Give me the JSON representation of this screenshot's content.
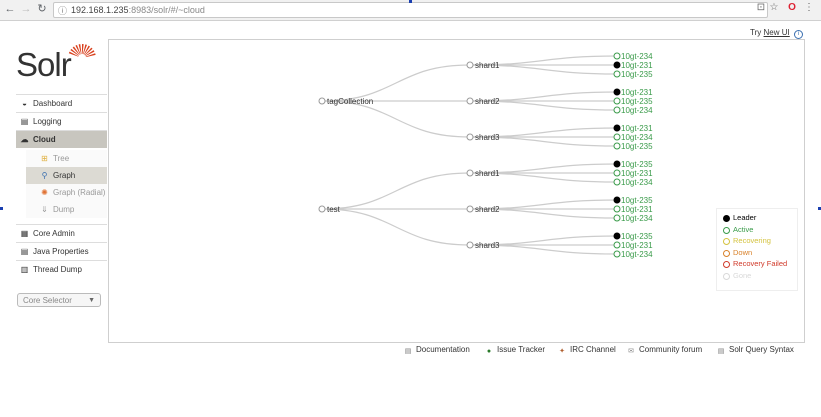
{
  "browser": {
    "url_host": "192.168.1.235",
    "url_path": ":8983/solr/#/~cloud"
  },
  "header": {
    "try_prefix": "Try",
    "new_ui_link": "New UI"
  },
  "logo": {
    "word": "Solr"
  },
  "sidebar": {
    "items": [
      {
        "label": "Dashboard",
        "icon": "dashboard-icon",
        "glyph": "◒"
      },
      {
        "label": "Logging",
        "icon": "logging-icon",
        "glyph": "▤"
      },
      {
        "label": "Cloud",
        "icon": "cloud-icon",
        "glyph": "☁"
      }
    ],
    "sub_items": [
      {
        "label": "Tree",
        "icon": "tree-icon",
        "glyph": "⊞"
      },
      {
        "label": "Graph",
        "icon": "graph-icon",
        "glyph": "⚲"
      },
      {
        "label": "Graph (Radial)",
        "icon": "radial-graph-icon",
        "glyph": "✺"
      },
      {
        "label": "Dump",
        "icon": "dump-icon",
        "glyph": "⇓"
      }
    ],
    "bottom_items": [
      {
        "label": "Core Admin",
        "icon": "core-admin-icon",
        "glyph": "▦"
      },
      {
        "label": "Java Properties",
        "icon": "java-properties-icon",
        "glyph": "▤"
      },
      {
        "label": "Thread Dump",
        "icon": "thread-dump-icon",
        "glyph": "▥"
      }
    ],
    "core_selector": "Core Selector"
  },
  "graph": {
    "collections": [
      {
        "name": "tagCollection",
        "shards": [
          {
            "name": "shard1",
            "replicas": [
              {
                "label": "10gt-234",
                "leader": false
              },
              {
                "label": "10gt-231",
                "leader": true
              },
              {
                "label": "10gt-235",
                "leader": false
              }
            ]
          },
          {
            "name": "shard2",
            "replicas": [
              {
                "label": "10gt-231",
                "leader": true
              },
              {
                "label": "10gt-235",
                "leader": false
              },
              {
                "label": "10gt-234",
                "leader": false
              }
            ]
          },
          {
            "name": "shard3",
            "replicas": [
              {
                "label": "10gt-231",
                "leader": true
              },
              {
                "label": "10gt-234",
                "leader": false
              },
              {
                "label": "10gt-235",
                "leader": false
              }
            ]
          }
        ]
      },
      {
        "name": "test",
        "shards": [
          {
            "name": "shard1",
            "replicas": [
              {
                "label": "10gt-235",
                "leader": true
              },
              {
                "label": "10gt-231",
                "leader": false
              },
              {
                "label": "10gt-234",
                "leader": false
              }
            ]
          },
          {
            "name": "shard2",
            "replicas": [
              {
                "label": "10gt-235",
                "leader": true
              },
              {
                "label": "10gt-231",
                "leader": false
              },
              {
                "label": "10gt-234",
                "leader": false
              }
            ]
          },
          {
            "name": "shard3",
            "replicas": [
              {
                "label": "10gt-235",
                "leader": true
              },
              {
                "label": "10gt-231",
                "leader": false
              },
              {
                "label": "10gt-234",
                "leader": false
              }
            ]
          }
        ]
      }
    ]
  },
  "legend": [
    {
      "label": "Leader",
      "color": "#000000",
      "fill": "#000000"
    },
    {
      "label": "Active",
      "color": "#3a9b4a",
      "fill": "#ffffff"
    },
    {
      "label": "Recovering",
      "color": "#d4c340",
      "fill": "#ffffff"
    },
    {
      "label": "Down",
      "color": "#d9822b",
      "fill": "#ffffff"
    },
    {
      "label": "Recovery Failed",
      "color": "#d03a2a",
      "fill": "#ffffff"
    },
    {
      "label": "Gone",
      "color": "#d9d9d9",
      "fill": "#ffffff"
    }
  ],
  "footer": [
    {
      "label": "Documentation",
      "icon": "documentation-icon",
      "glyph": "▤"
    },
    {
      "label": "Issue Tracker",
      "icon": "issue-tracker-icon",
      "glyph": "●"
    },
    {
      "label": "IRC Channel",
      "icon": "irc-channel-icon",
      "glyph": "✦"
    },
    {
      "label": "Community forum",
      "icon": "community-forum-icon",
      "glyph": "✉"
    },
    {
      "label": "Solr Query Syntax",
      "icon": "query-syntax-icon",
      "glyph": "▤"
    }
  ]
}
